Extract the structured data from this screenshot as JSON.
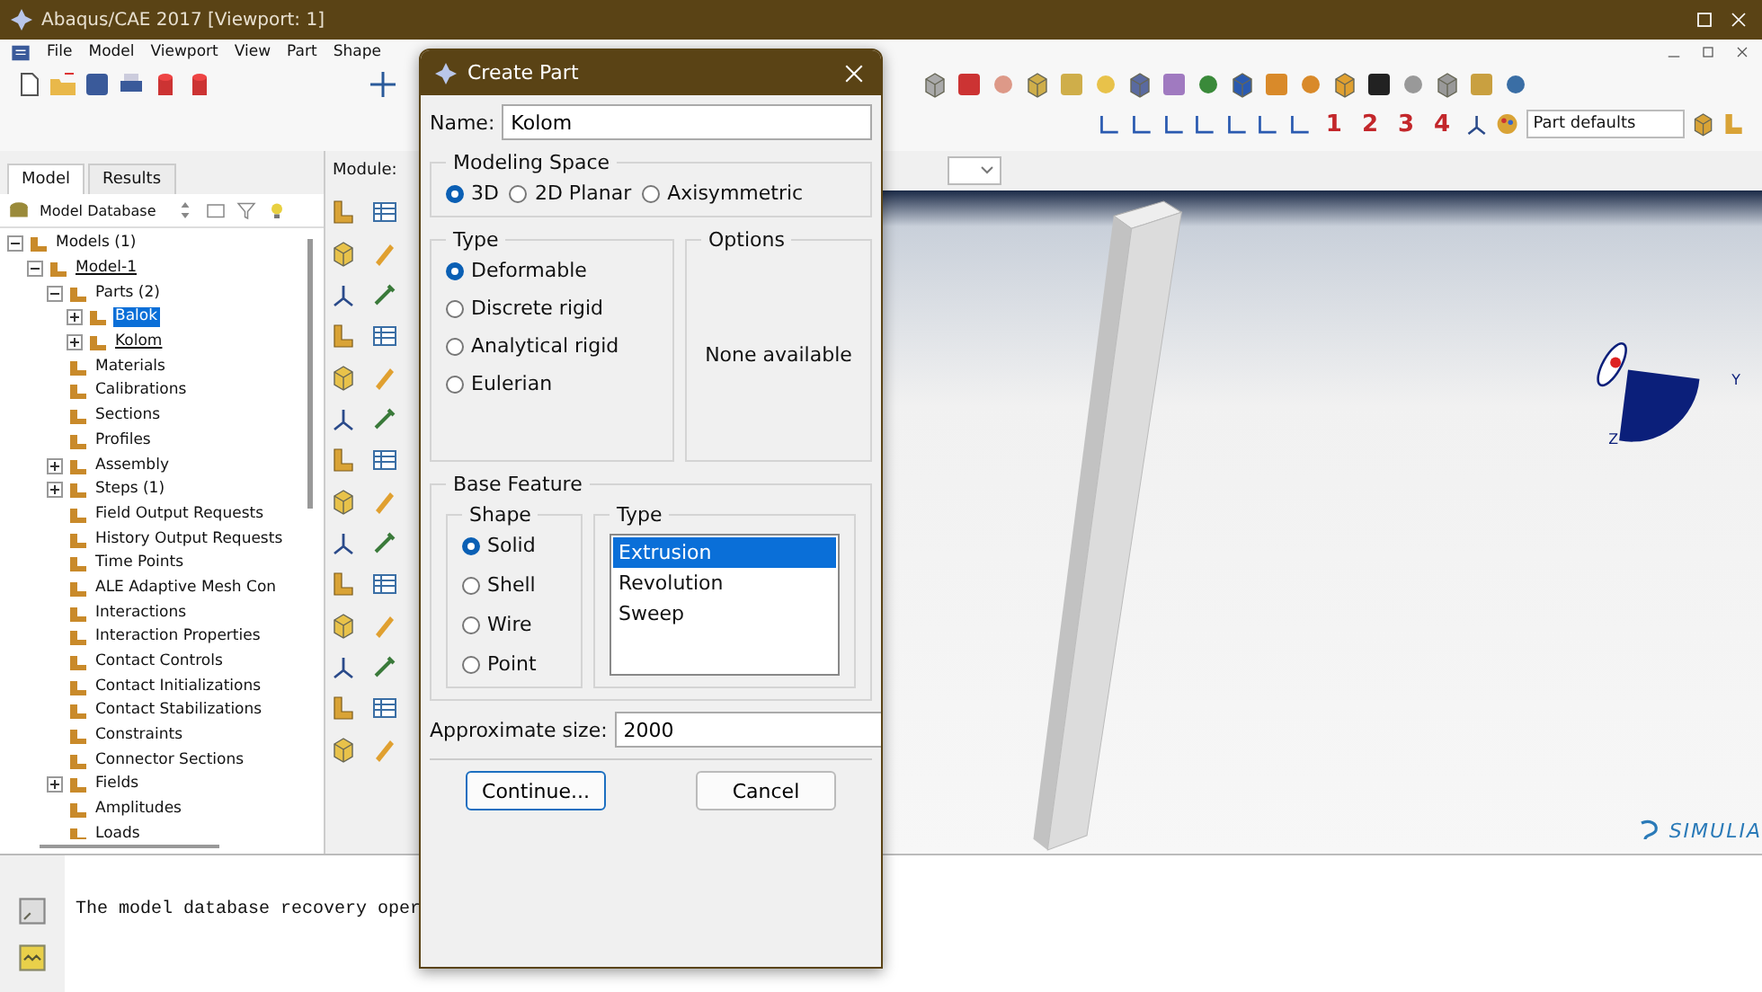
{
  "window": {
    "title": "Abaqus/CAE 2017 [Viewport: 1]"
  },
  "menu": [
    "File",
    "Model",
    "Viewport",
    "View",
    "Part",
    "Shape"
  ],
  "toolbar": {
    "view_numbers": [
      "1",
      "2",
      "3",
      "4"
    ],
    "render_style": "Part defaults"
  },
  "module": {
    "label": "Module:"
  },
  "tabs": [
    {
      "label": "Model",
      "selected": true
    },
    {
      "label": "Results",
      "selected": false
    }
  ],
  "database": "Model Database",
  "tree": [
    {
      "label": "Models (1)",
      "expanded": true,
      "selected": false,
      "children": [
        {
          "label": "Model-1",
          "expanded": true,
          "selected": false,
          "current": true,
          "children": [
            {
              "label": "Parts (2)",
              "expanded": true,
              "selected": false,
              "children": [
                {
                  "label": "Balok",
                  "expanded": false,
                  "selected": true
                },
                {
                  "label": "Kolom",
                  "expanded": false,
                  "selected": false,
                  "current": true
                }
              ]
            },
            {
              "label": "Materials",
              "selected": false
            },
            {
              "label": "Calibrations",
              "selected": false
            },
            {
              "label": "Sections",
              "selected": false
            },
            {
              "label": "Profiles",
              "selected": false
            },
            {
              "label": "Assembly",
              "expanded": false,
              "selected": false
            },
            {
              "label": "Steps (1)",
              "expanded": false,
              "selected": false
            },
            {
              "label": "Field Output Requests",
              "selected": false
            },
            {
              "label": "History Output Requests",
              "selected": false
            },
            {
              "label": "Time Points",
              "selected": false
            },
            {
              "label": "ALE Adaptive Mesh Con",
              "selected": false
            },
            {
              "label": "Interactions",
              "selected": false
            },
            {
              "label": "Interaction Properties",
              "selected": false
            },
            {
              "label": "Contact Controls",
              "selected": false
            },
            {
              "label": "Contact Initializations",
              "selected": false
            },
            {
              "label": "Contact Stabilizations",
              "selected": false
            },
            {
              "label": "Constraints",
              "selected": false
            },
            {
              "label": "Connector Sections",
              "selected": false
            },
            {
              "label": "Fields",
              "expanded": false,
              "selected": false
            },
            {
              "label": "Amplitudes",
              "selected": false
            },
            {
              "label": "Loads",
              "selected": false
            }
          ]
        }
      ]
    }
  ],
  "viewport": {
    "triad_labels": [
      "Y",
      "Z"
    ],
    "logo": "SIMULIA"
  },
  "message": "The model database recovery oper",
  "dialog": {
    "title": "Create Part",
    "name_label": "Name:",
    "name_value": "Kolom",
    "modeling_space": {
      "title": "Modeling Space",
      "options": [
        {
          "label": "3D",
          "selected": true
        },
        {
          "label": "2D Planar",
          "selected": false
        },
        {
          "label": "Axisymmetric",
          "selected": false
        }
      ]
    },
    "type": {
      "title": "Type",
      "options": [
        {
          "label": "Deformable",
          "selected": true
        },
        {
          "label": "Discrete rigid",
          "selected": false
        },
        {
          "label": "Analytical rigid",
          "selected": false
        },
        {
          "label": "Eulerian",
          "selected": false
        }
      ]
    },
    "options": {
      "title": "Options",
      "text": "None available"
    },
    "base_feature": {
      "title": "Base Feature",
      "shape": {
        "title": "Shape",
        "options": [
          {
            "label": "Solid",
            "selected": true
          },
          {
            "label": "Shell",
            "selected": false
          },
          {
            "label": "Wire",
            "selected": false
          },
          {
            "label": "Point",
            "selected": false
          }
        ]
      },
      "type": {
        "title": "Type",
        "items": [
          {
            "label": "Extrusion",
            "selected": true
          },
          {
            "label": "Revolution",
            "selected": false
          },
          {
            "label": "Sweep",
            "selected": false
          }
        ]
      }
    },
    "size_label": "Approximate size:",
    "size_value": "2000",
    "buttons": [
      {
        "label": "Continue...",
        "default": true
      },
      {
        "label": "Cancel",
        "default": false
      }
    ]
  }
}
